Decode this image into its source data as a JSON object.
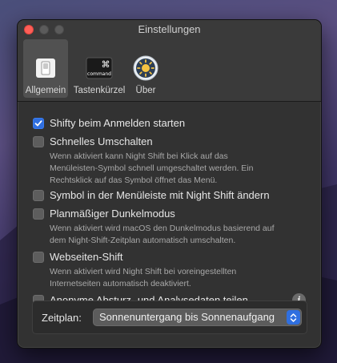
{
  "window": {
    "title": "Einstellungen"
  },
  "tabs": [
    {
      "label": "Allgemein",
      "active": true,
      "icon": "switch-icon"
    },
    {
      "label": "Tastenkürzel",
      "active": false,
      "icon": "command-key-icon",
      "key_glyph": "⌘",
      "key_text": "command"
    },
    {
      "label": "Über",
      "active": false,
      "icon": "sun-app-icon"
    }
  ],
  "settings": {
    "launch_at_login": {
      "label": "Shifty beim Anmelden starten",
      "checked": true
    },
    "quick_toggle": {
      "label": "Schnelles Umschalten",
      "checked": false,
      "description_lines": [
        "Wenn aktiviert kann Night Shift bei Klick auf das",
        "Menüleisten-Symbol schnell umgeschaltet werden. Ein",
        "Rechtsklick auf das Symbol öffnet das Menü."
      ]
    },
    "change_icon": {
      "label": "Symbol in der Menüleiste mit Night Shift ändern",
      "checked": false
    },
    "dark_mode": {
      "label": "Planmäßiger Dunkelmodus",
      "checked": false,
      "description_lines": [
        "Wenn aktiviert wird macOS den Dunkelmodus basierend auf",
        "dem Night-Shift-Zeitplan automatisch umschalten."
      ]
    },
    "website_shift": {
      "label": "Webseiten-Shift",
      "checked": false,
      "description_lines": [
        "Wenn aktiviert wird Night Shift bei voreingestellten",
        "Internetseiten automatisch deaktiviert."
      ]
    },
    "analytics": {
      "label": "Anonyme Absturz- und Analysedaten teilen",
      "checked": false,
      "info_glyph": "i"
    }
  },
  "schedule": {
    "label": "Zeitplan:",
    "selected": "Sonnenuntergang bis Sonnenaufgang"
  },
  "colors": {
    "accent": "#2f6fe0",
    "close_button": "#ff5f57",
    "window_bg": "#323232"
  }
}
